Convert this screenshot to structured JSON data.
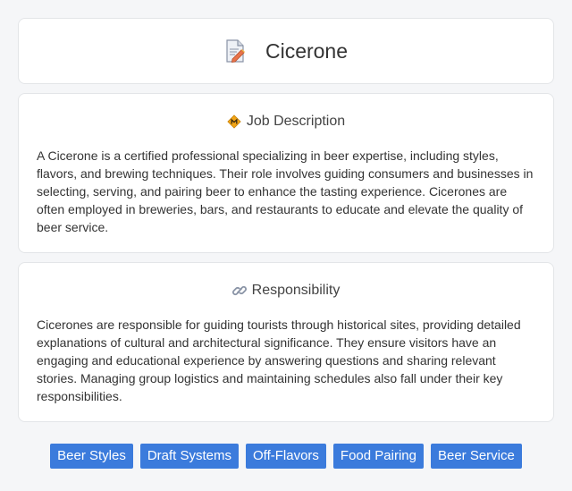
{
  "header": {
    "title": "Cicerone",
    "icon": "document-pencil-icon"
  },
  "job_description": {
    "heading": "Job Description",
    "icon": "badge-diamond-icon",
    "body": "A Cicerone is a certified professional specializing in beer expertise, including styles, flavors, and brewing techniques. Their role involves guiding consumers and businesses in selecting, serving, and pairing beer to enhance the tasting experience. Cicerones are often employed in breweries, bars, and restaurants to educate and elevate the quality of beer service."
  },
  "responsibility": {
    "heading": "Responsibility",
    "icon": "link-icon",
    "body": "Cicerones are responsible for guiding tourists through historical sites, providing detailed explanations of cultural and architectural significance. They ensure visitors have an engaging and educational experience by answering questions and sharing relevant stories. Managing group logistics and maintaining schedules also fall under their key responsibilities."
  },
  "tags": [
    "Beer Styles",
    "Draft Systems",
    "Off-Flavors",
    "Food Pairing",
    "Beer Service"
  ],
  "colors": {
    "tag_background": "#3b7bdc",
    "page_background": "#f5f6f8"
  }
}
